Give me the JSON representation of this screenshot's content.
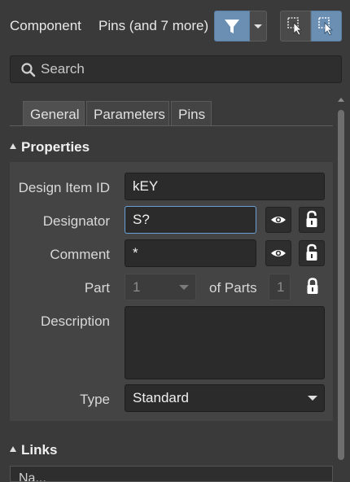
{
  "header": {
    "component_label": "Component",
    "pins_label": "Pins (and 7 more)"
  },
  "search": {
    "placeholder": "Search"
  },
  "tabs": [
    {
      "label": "General",
      "active": true
    },
    {
      "label": "Parameters",
      "active": false
    },
    {
      "label": "Pins",
      "active": false
    }
  ],
  "properties": {
    "section_title": "Properties",
    "design_item_id": {
      "label": "Design Item ID",
      "value": "kEY"
    },
    "designator": {
      "label": "Designator",
      "value": "S?"
    },
    "comment": {
      "label": "Comment",
      "value": "*"
    },
    "part": {
      "label": "Part",
      "value": "1",
      "of_parts_label": "of Parts",
      "of_parts_value": "1"
    },
    "description": {
      "label": "Description",
      "value": ""
    },
    "type": {
      "label": "Type",
      "value": "Standard"
    }
  },
  "links": {
    "section_title": "Links",
    "first_column": "Na..."
  },
  "colors": {
    "accent": "#6a8fb3",
    "focus": "#6aa0d8",
    "background": "#3a3a3a"
  }
}
